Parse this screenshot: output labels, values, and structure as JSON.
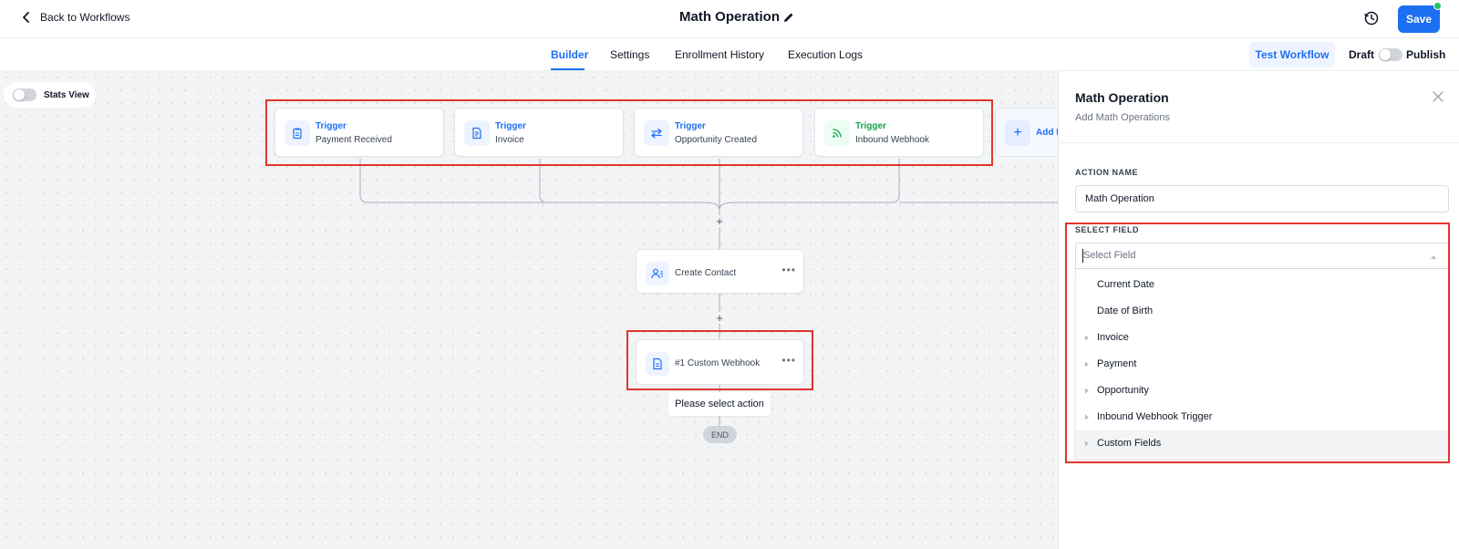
{
  "header": {
    "back_label": "Back to Workflows",
    "title": "Math Operation",
    "save_label": "Save"
  },
  "tabs": [
    {
      "label": "Builder",
      "active": true
    },
    {
      "label": "Settings",
      "active": false
    },
    {
      "label": "Enrollment History",
      "active": false
    },
    {
      "label": "Execution Logs",
      "active": false
    }
  ],
  "toolbar": {
    "test_workflow_label": "Test Workflow",
    "draft_label": "Draft",
    "publish_label": "Publish",
    "published": false
  },
  "canvas": {
    "stats_view_label": "Stats View",
    "stats_view_on": false,
    "triggers": [
      {
        "kind": "Trigger",
        "name": "Payment Received",
        "icon": "clipboard-icon",
        "color": "#1d6ff2"
      },
      {
        "kind": "Trigger",
        "name": "Invoice",
        "icon": "invoice-icon",
        "color": "#1d6ff2"
      },
      {
        "kind": "Trigger",
        "name": "Opportunity Created",
        "icon": "swap-arrows-icon",
        "color": "#1d6ff2"
      },
      {
        "kind": "Trigger",
        "name": "Inbound Webhook",
        "icon": "rss-icon",
        "color": "#16a34a"
      }
    ],
    "add_trigger_label": "Add N",
    "actions": [
      {
        "label": "Create Contact",
        "icon": "user-list-icon"
      },
      {
        "label": "#1 Custom Webhook",
        "icon": "document-icon"
      }
    ],
    "warning_text": "Please select action",
    "end_label": "END"
  },
  "panel": {
    "title": "Math Operation",
    "subtitle": "Add Math Operations",
    "action_name_label": "ACTION NAME",
    "action_name_value": "Math Operation",
    "select_field_label": "SELECT FIELD",
    "select_field_placeholder": "Select Field",
    "options": [
      {
        "label": "Current Date",
        "expandable": false
      },
      {
        "label": "Date of Birth",
        "expandable": false
      },
      {
        "label": "Invoice",
        "expandable": true
      },
      {
        "label": "Payment",
        "expandable": true
      },
      {
        "label": "Opportunity",
        "expandable": true
      },
      {
        "label": "Inbound Webhook Trigger",
        "expandable": true
      },
      {
        "label": "Custom Fields",
        "expandable": true
      }
    ]
  },
  "colors": {
    "accent": "#1d6ff2",
    "highlight_box": "#e0362c",
    "status_online": "#22c55e"
  }
}
